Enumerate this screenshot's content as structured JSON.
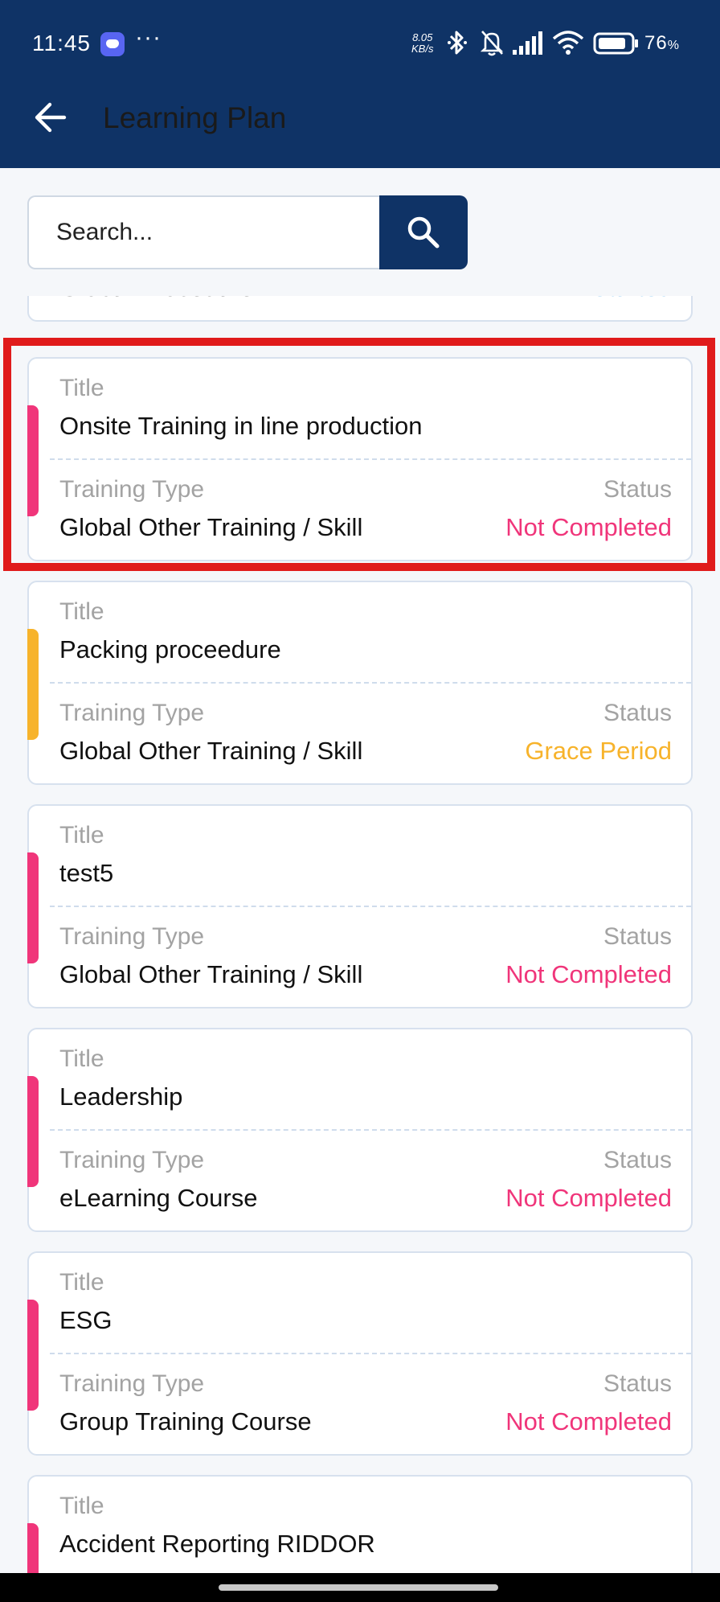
{
  "status_bar": {
    "time": "11:45",
    "more": "···",
    "net_speed_top": "8.05",
    "net_speed_bottom": "KB/s",
    "battery_pct": "76",
    "battery_unit": "%",
    "icons": [
      "discord-icon",
      "bluetooth-icon",
      "bell-muted-icon",
      "signal-icon",
      "wifi-icon",
      "battery-icon"
    ]
  },
  "app_bar": {
    "title": "Learning Plan",
    "back_icon": "arrow-left-icon"
  },
  "search": {
    "placeholder": "Search...",
    "icon": "search-icon"
  },
  "partial_card": {
    "title": "Global Procedure",
    "status": "Started",
    "status_color": "#2e9be6"
  },
  "labels": {
    "title": "Title",
    "training_type": "Training Type",
    "status": "Status"
  },
  "cards": [
    {
      "title": "Onsite Training in line production",
      "training_type": "Global Other Training / Skill",
      "status": "Not Completed",
      "status_color": "#f0357a"
    },
    {
      "title": "Packing proceedure",
      "training_type": "Global Other Training / Skill",
      "status": "Grace Period",
      "status_color": "#f7b32b"
    },
    {
      "title": "test5",
      "training_type": "Global Other Training / Skill",
      "status": "Not Completed",
      "status_color": "#f0357a"
    },
    {
      "title": "Leadership",
      "training_type": "eLearning Course",
      "status": "Not Completed",
      "status_color": "#f0357a"
    },
    {
      "title": "ESG",
      "training_type": "Group Training Course",
      "status": "Not Completed",
      "status_color": "#f0357a"
    },
    {
      "title": "Accident Reporting RIDDOR",
      "training_type": "",
      "status": "",
      "status_color": "#f0357a"
    }
  ],
  "colors": {
    "brand": "#0f3366",
    "highlight": "#e01b1b",
    "not_completed": "#f0357a",
    "grace_period": "#f7b32b",
    "started": "#2e9be6"
  }
}
